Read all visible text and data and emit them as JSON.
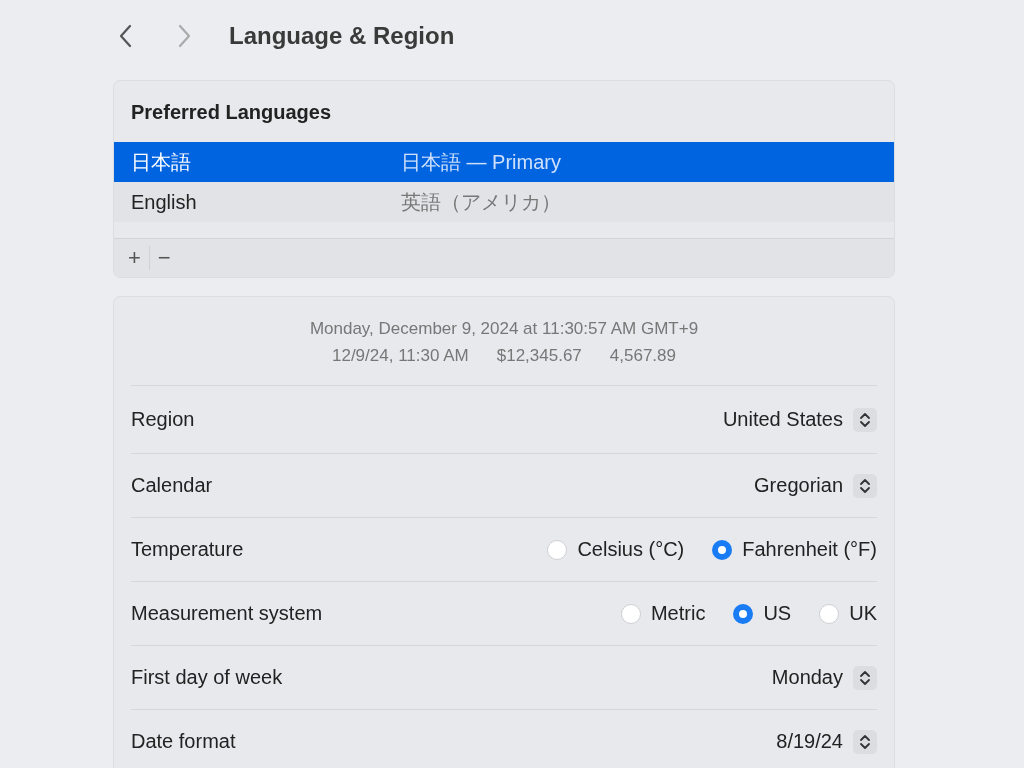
{
  "title": "Language & Region",
  "preferred_languages": {
    "heading": "Preferred Languages",
    "items": [
      {
        "name": "日本語",
        "detail": "日本語 — Primary",
        "selected": true
      },
      {
        "name": "English",
        "detail": "英語（アメリカ）",
        "selected": false
      }
    ],
    "toolbar": [
      "+",
      "−"
    ]
  },
  "preview": {
    "line_1": "Monday, December 9, 2024 at 11:30:57 AM GMT+9",
    "line_2": [
      "12/9/24, 11:30 AM",
      "$12,345.67",
      "4,567.89"
    ]
  },
  "settings": [
    {
      "kind": "popup",
      "label": "Region",
      "value": "United States"
    },
    {
      "kind": "popup",
      "label": "Calendar",
      "value": "Gregorian"
    },
    {
      "kind": "radio",
      "label": "Temperature",
      "options": [
        {
          "label": "Celsius (°C)",
          "selected": false
        },
        {
          "label": "Fahrenheit (°F)",
          "selected": true
        }
      ]
    },
    {
      "kind": "radio",
      "label": "Measurement system",
      "options": [
        {
          "label": "Metric",
          "selected": false
        },
        {
          "label": "US",
          "selected": true
        },
        {
          "label": "UK",
          "selected": false
        }
      ]
    },
    {
      "kind": "popup",
      "label": "First day of week",
      "value": "Monday"
    },
    {
      "kind": "popup",
      "label": "Date format",
      "value": "8/19/24"
    }
  ]
}
